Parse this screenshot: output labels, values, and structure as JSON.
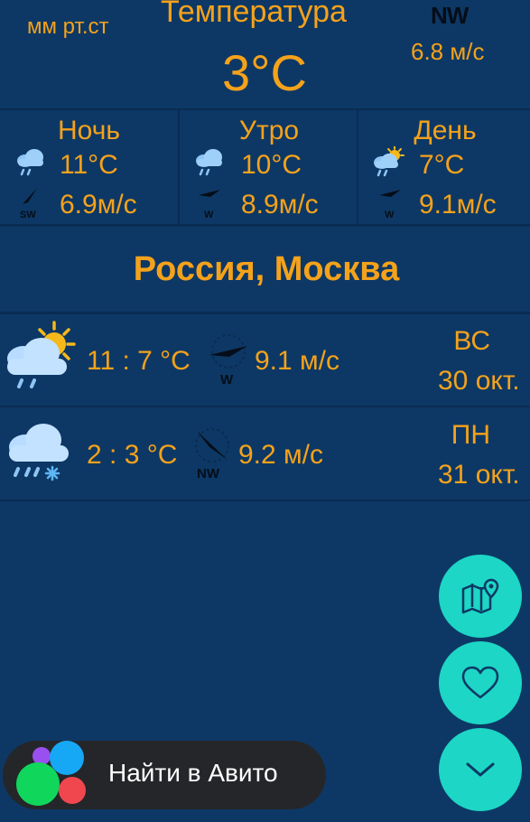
{
  "header": {
    "pressure_unit": "мм рт.ст",
    "temperature_title": "Температура",
    "temperature_value": "3°C",
    "wind_direction": "NW",
    "wind_speed": "6.8 м/с"
  },
  "forecast": [
    {
      "title": "Ночь",
      "temp": "11°C",
      "wind": "6.9м/с",
      "wind_dir": "SW",
      "weather_icon": "rain-cloud-icon"
    },
    {
      "title": "Утро",
      "temp": "10°C",
      "wind": "8.9м/с",
      "wind_dir": "W",
      "weather_icon": "rain-cloud-icon"
    },
    {
      "title": "День",
      "temp": "7°C",
      "wind": "9.1м/с",
      "wind_dir": "W",
      "weather_icon": "sun-rain-cloud-icon"
    }
  ],
  "city": "Россия, Москва",
  "days": [
    {
      "temp": "11 : 7 °C",
      "wind": "9.1 м/с",
      "wind_dir": "W",
      "weekday": "ВС",
      "date": "30 окт.",
      "weather_icon": "sun-rain-cloud-icon"
    },
    {
      "temp": "2 : 3 °C",
      "wind": "9.2 м/с",
      "wind_dir": "NW",
      "weekday": "ПН",
      "date": "31 окт.",
      "weather_icon": "rain-snow-cloud-icon"
    }
  ],
  "fabs": [
    "map-pin-icon",
    "heart-icon",
    "chevron-down-icon"
  ],
  "avito": {
    "label": "Найти в Авито"
  },
  "colors": {
    "background": "#0d3865",
    "accent": "#f5a21b",
    "fab": "#1dd6c5",
    "pill": "#252629"
  }
}
